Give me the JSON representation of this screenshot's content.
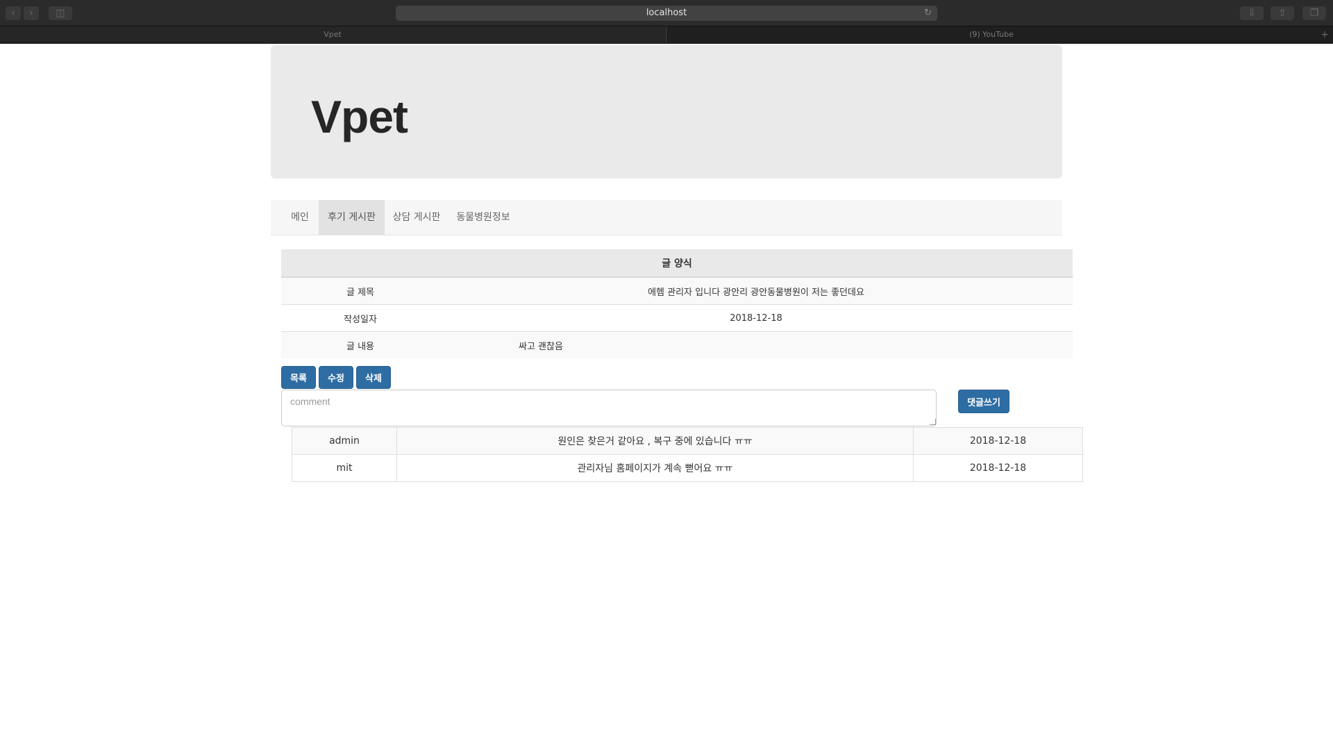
{
  "browser": {
    "address": "localhost",
    "tabs": [
      {
        "label": "Vpet",
        "active": true
      },
      {
        "label": "(9) YouTube",
        "active": false
      }
    ]
  },
  "site": {
    "brand": "Vpet",
    "nav": [
      {
        "label": "메인",
        "active": false
      },
      {
        "label": "후기 게시판",
        "active": true
      },
      {
        "label": "상담 게시판",
        "active": false
      },
      {
        "label": "동물병원정보",
        "active": false
      }
    ]
  },
  "post": {
    "header": "글 양식",
    "title_label": "글 제목",
    "title": "에헴 관리자 입니다 광안리 광안동물병원이 저는 좋던데요",
    "date_label": "작성일자",
    "date": "2018-12-18",
    "content_label": "글 내용",
    "content": "싸고 괜찮음"
  },
  "actions": {
    "list": "목록",
    "edit": "수정",
    "delete": "삭제"
  },
  "comment_form": {
    "placeholder": "comment",
    "submit": "댓글쓰기"
  },
  "comments": [
    {
      "user": "admin",
      "text": "원인은 찾은거 같아요 , 복구 중에 있습니다 ㅠㅠ",
      "date": "2018-12-18"
    },
    {
      "user": "mit",
      "text": "관리자님 홈페이지가 계속 뻗어요 ㅠㅠ",
      "date": "2018-12-18"
    }
  ]
}
